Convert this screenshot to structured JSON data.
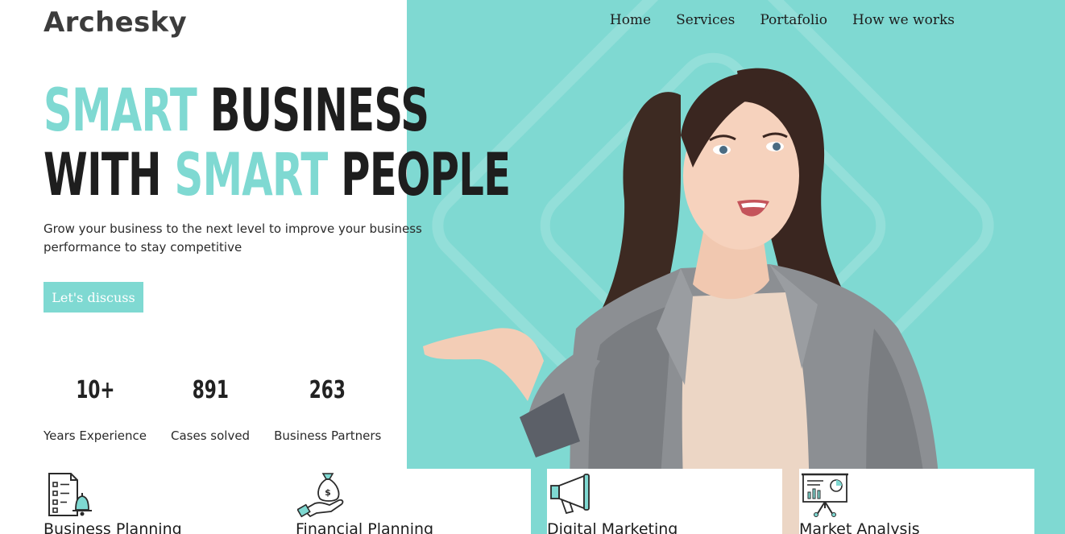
{
  "brand": {
    "logo_text": "Archesky",
    "accent_color": "#7fd9d2"
  },
  "nav": {
    "items": [
      {
        "label": "Home"
      },
      {
        "label": "Services"
      },
      {
        "label": "Portafolio"
      },
      {
        "label": "How we works"
      }
    ]
  },
  "hero": {
    "line1_accent": "SMART",
    "line1_rest": "BUSINESS",
    "line2_start": "WITH",
    "line2_accent": "SMART",
    "line2_end": "PEOPLE",
    "subtitle": "Grow your business to the next level to improve your business performance to stay competitive",
    "cta_label": "Let's discuss"
  },
  "stats": [
    {
      "value": "10+",
      "label": "Years Experience"
    },
    {
      "value": "891",
      "label": "Cases solved"
    },
    {
      "value": "263",
      "label": "Business Partners"
    }
  ],
  "services": [
    {
      "title": "Business Planning",
      "icon": "checklist-bell-icon"
    },
    {
      "title": "Financial Planning",
      "icon": "money-bag-hand-icon"
    },
    {
      "title": "Digital Marketing",
      "icon": "megaphone-icon"
    },
    {
      "title": "Market Analysis",
      "icon": "presentation-board-icon"
    }
  ]
}
